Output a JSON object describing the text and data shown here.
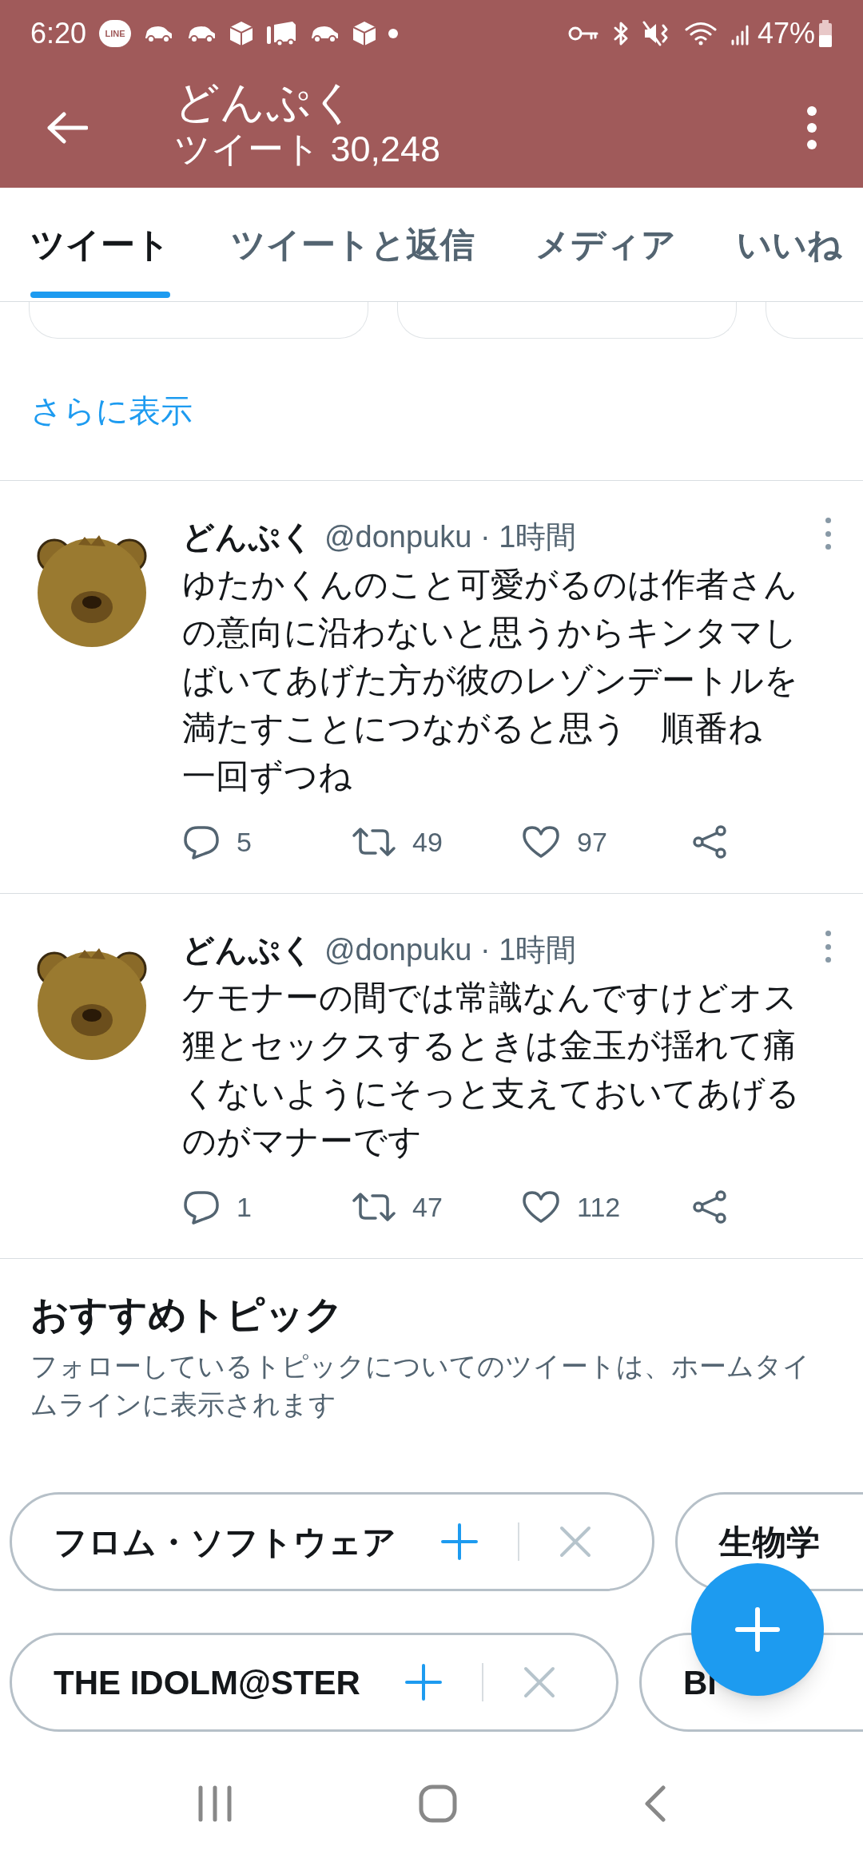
{
  "status_bar": {
    "time": "6:20",
    "notifications": [
      {
        "kind": "chat",
        "label": "LINE"
      },
      {
        "kind": "car"
      },
      {
        "kind": "car"
      },
      {
        "kind": "box"
      },
      {
        "kind": "bus"
      },
      {
        "kind": "car"
      },
      {
        "kind": "box"
      },
      {
        "kind": "dot"
      }
    ],
    "battery": "47%"
  },
  "header": {
    "title": "どんぷく",
    "subtitle": "ツイート 30,248"
  },
  "tabs": [
    {
      "label": "ツイート",
      "selected": true
    },
    {
      "label": "ツイートと返信",
      "selected": false
    },
    {
      "label": "メディア",
      "selected": false
    },
    {
      "label": "いいね",
      "selected": false
    }
  ],
  "show_more": "さらに表示",
  "tweets": [
    {
      "name": "どんぷく",
      "meta": "@donpuku · 1時間",
      "paragraphs": [
        "ゆたかくんのこと可愛がるのは作者さんの意向に沿わないと思うからキンタマしばいてあげた方が彼のレゾンデートルを満たすことにつながると思う　順番ね",
        "一回ずつね"
      ],
      "replies": "5",
      "retweets": "49",
      "likes": "97"
    },
    {
      "name": "どんぷく",
      "meta": "@donpuku · 1時間",
      "paragraphs": [
        "ケモナーの間では常識なんですけどオス狸とセックスするときは金玉が揺れて痛くないようにそっと支えておいてあげるのがマナーです"
      ],
      "replies": "1",
      "retweets": "47",
      "likes": "112"
    }
  ],
  "topics": {
    "title": "おすすめトピック",
    "subtitle": "フォローしているトピックについてのツイートは、ホームタイムラインに表示されます",
    "rows": [
      [
        {
          "label": "フロム・ソフトウェア",
          "kind": "full"
        },
        {
          "label": "生物学",
          "kind": "cut"
        }
      ],
      [
        {
          "label": "THE IDOLM@STER",
          "kind": "full"
        },
        {
          "label": "Bl",
          "kind": "cut"
        }
      ]
    ]
  }
}
